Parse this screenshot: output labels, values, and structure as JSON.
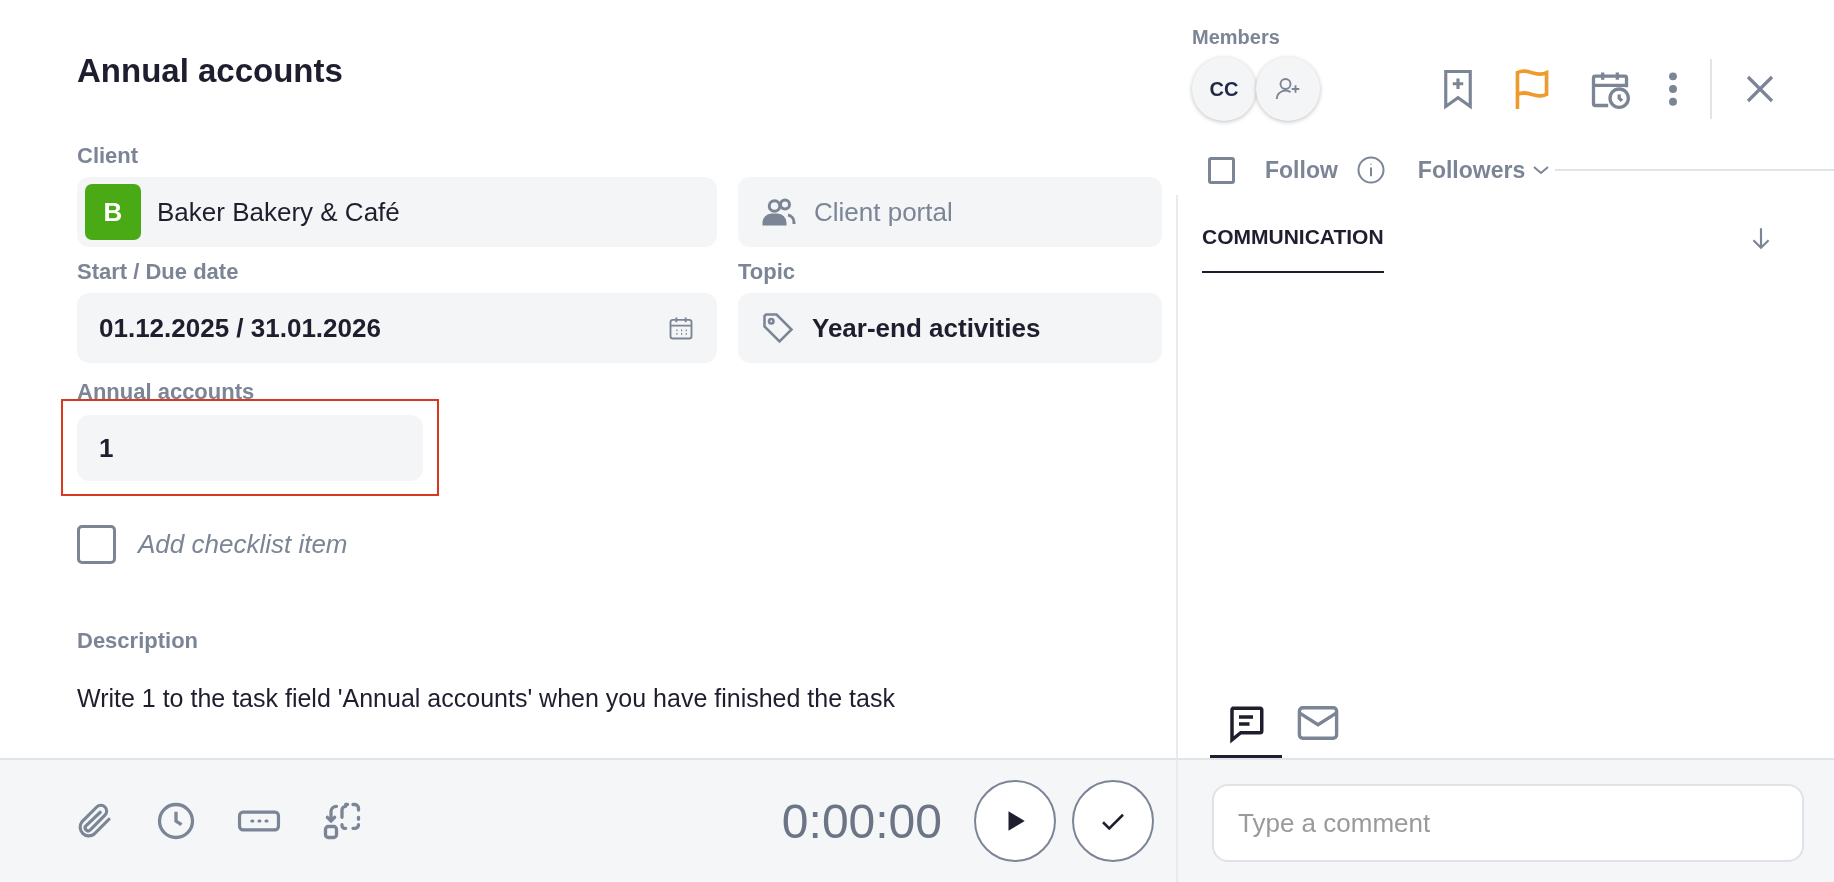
{
  "title": "Annual accounts",
  "client": {
    "label": "Client",
    "initial": "B",
    "value": "Baker Bakery & Café"
  },
  "client_portal": {
    "label": "Client portal"
  },
  "dates": {
    "label": "Start / Due date",
    "value": "01.12.2025 / 31.01.2026"
  },
  "topic": {
    "label": "Topic",
    "value": "Year-end activities"
  },
  "custom_field": {
    "label": "Annual accounts",
    "value": "1",
    "highlighted": true
  },
  "checklist": {
    "placeholder": "Add checklist item",
    "checked": false
  },
  "description": {
    "label": "Description",
    "text": "Write 1 to the task field 'Annual accounts' when you have finished the task"
  },
  "timer": "0:00:00",
  "members": {
    "label": "Members",
    "items": [
      {
        "initials": "CC"
      }
    ]
  },
  "flagged": true,
  "follow": {
    "label": "Follow",
    "checked": false
  },
  "followers": "Followers",
  "tabs": [
    {
      "label": "COMMUNICATION",
      "selected": true
    }
  ],
  "comm_tabs": [
    {
      "kind": "comment",
      "selected": true
    },
    {
      "kind": "email",
      "selected": false
    }
  ],
  "comment": {
    "placeholder": "Type a comment"
  }
}
